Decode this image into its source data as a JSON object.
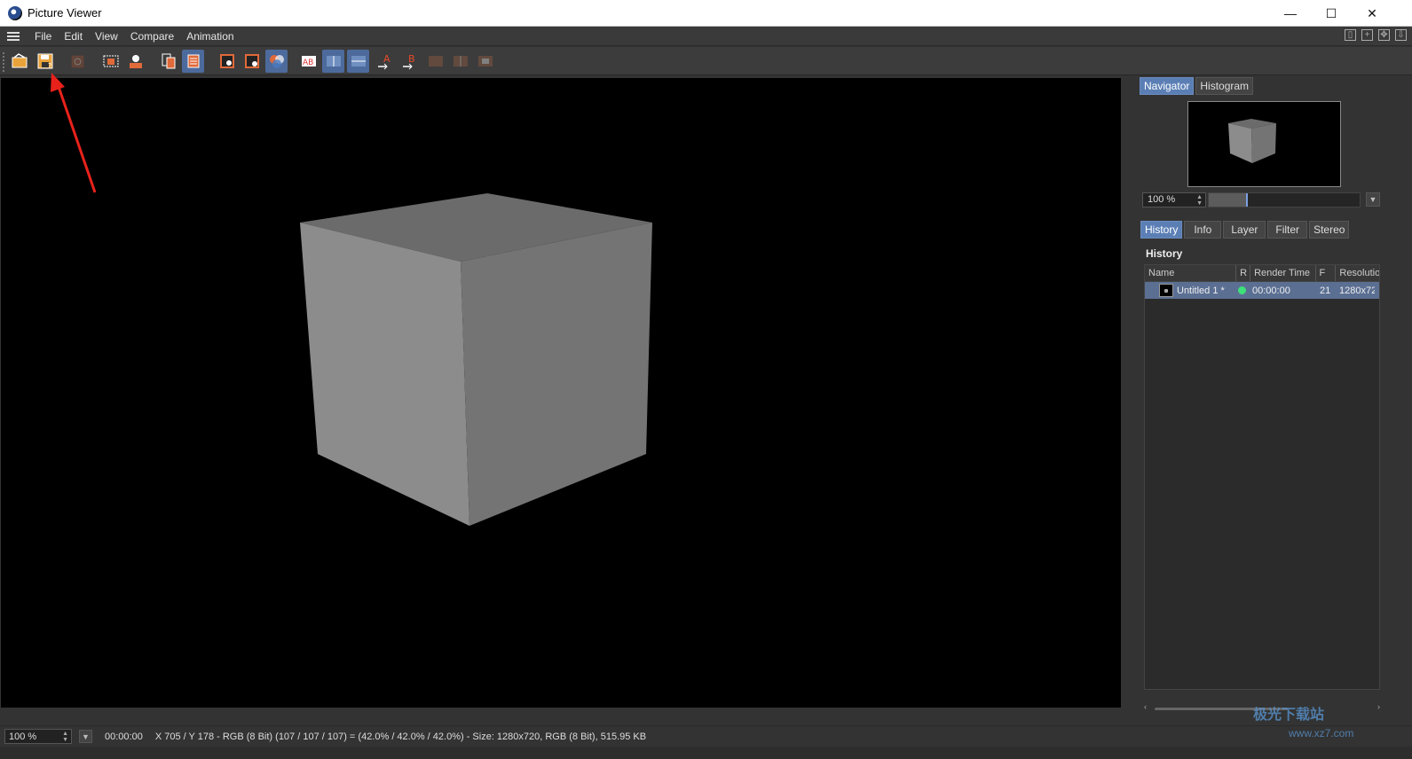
{
  "window": {
    "title": "Picture Viewer",
    "minimize": "—",
    "maximize": "☐",
    "close": "✕"
  },
  "menu": [
    "File",
    "Edit",
    "View",
    "Compare",
    "Animation"
  ],
  "toolbar_icons": [
    "open-icon",
    "save-icon",
    "stop-render-icon",
    "region-render-icon",
    "user-render-icon",
    "copy-frame-icon",
    "stack-icon",
    "display-mode-a-icon",
    "display-mode-b-icon",
    "display-mode-c-icon",
    "ab-compare-icon",
    "ab-split-horizontal-icon",
    "ab-split-vertical-icon",
    "set-a-icon",
    "set-b-icon",
    "swap-ab-icon",
    "compare-left-icon",
    "compare-right-icon"
  ],
  "navigator": {
    "tabs": [
      "Navigator",
      "Histogram"
    ],
    "zoom": "100 %",
    "zoom_fraction": 0.25
  },
  "panel_tabs": [
    "History",
    "Info",
    "Layer",
    "Filter",
    "Stereo"
  ],
  "history": {
    "heading": "History",
    "columns": [
      "Name",
      "R",
      "Render Time",
      "F",
      "Resolutio"
    ],
    "rows": [
      {
        "name": "Untitled 1 *",
        "render_time": "00:00:00",
        "frames": "21",
        "resolution": "1280x72"
      }
    ]
  },
  "status": {
    "zoom": "100 %",
    "time": "00:00:00",
    "info": "X 705 / Y 178 - RGB (8 Bit) (107 / 107 / 107) = (42.0% / 42.0% / 42.0%) - Size: 1280x720, RGB (8 Bit), 515.95 KB"
  },
  "watermark": {
    "main": "极光下载站",
    "sub": "www.xz7.com"
  },
  "colors": {
    "accent": "#5b7fb5",
    "annotation_arrow": "#e8221b",
    "status_dot": "#3ee07a",
    "cube_top": "#6b6b6b",
    "cube_left": "#8c8c8c",
    "cube_right": "#747474"
  }
}
